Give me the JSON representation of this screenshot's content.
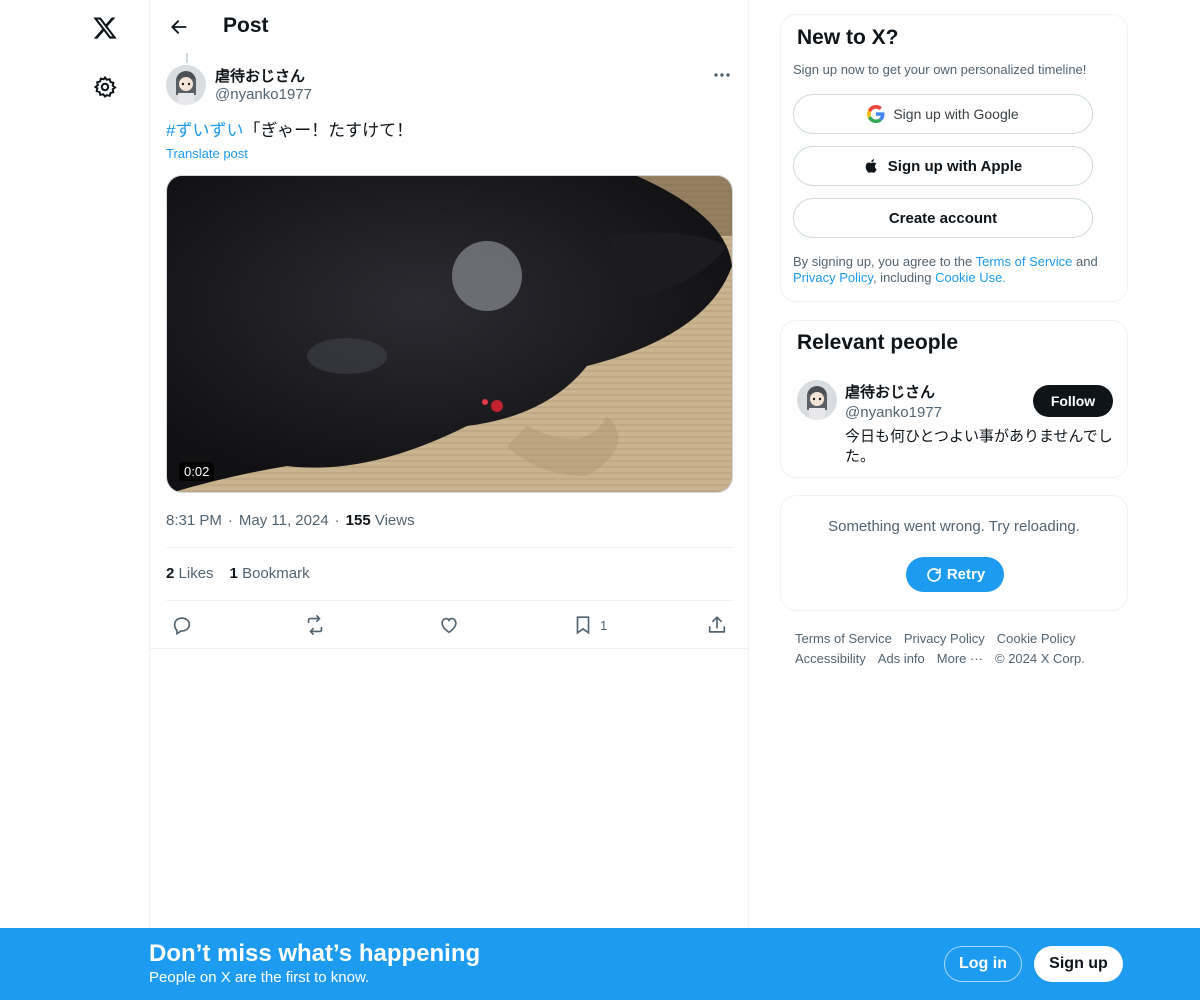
{
  "nav": {
    "logo_icon": "x-logo-icon",
    "settings_icon": "gear-icon"
  },
  "header": {
    "title": "Post",
    "back_icon": "arrow-left-icon"
  },
  "post": {
    "author_name": "虐待おじさん",
    "author_handle": "@nyanko1977",
    "hashtag": "#ずいずい",
    "text": "「ぎゃー！たすけて！",
    "translate_label": "Translate post",
    "video_duration": "0:02",
    "time": "8:31 PM",
    "date": "May 11, 2024",
    "separator": "·",
    "views_count": "155",
    "views_label": "Views",
    "likes_count": "2",
    "likes_label": "Likes",
    "bookmarks_count": "1",
    "bookmarks_label": "Bookmark",
    "bookmark_action_count": "1"
  },
  "signup": {
    "title": "New to X?",
    "subtitle": "Sign up now to get your own personalized timeline!",
    "google_label": "Sign up with Google",
    "apple_label": "Sign up with Apple",
    "create_label": "Create account",
    "terms_prefix": "By signing up, you agree to the ",
    "terms_link": "Terms of Service",
    "terms_and": " and ",
    "privacy_link": "Privacy Policy",
    "terms_including": ", including ",
    "cookie_link": "Cookie Use."
  },
  "relevant": {
    "title": "Relevant people",
    "name": "虐待おじさん",
    "handle": "@nyanko1977",
    "bio": "今日も何ひとつよい事がありませんでした。",
    "follow_label": "Follow"
  },
  "error": {
    "message": "Something went wrong. Try reloading.",
    "retry_label": "Retry"
  },
  "footer": {
    "links": [
      "Terms of Service",
      "Privacy Policy",
      "Cookie Policy",
      "Accessibility",
      "Ads info",
      "More ···"
    ],
    "copyright": "© 2024 X Corp."
  },
  "banner": {
    "title": "Don’t miss what’s happening",
    "subtitle": "People on X are the first to know.",
    "login_label": "Log in",
    "signup_label": "Sign up"
  },
  "colors": {
    "accent": "#1d9bf0",
    "text": "#0f1419",
    "secondary": "#536471"
  }
}
